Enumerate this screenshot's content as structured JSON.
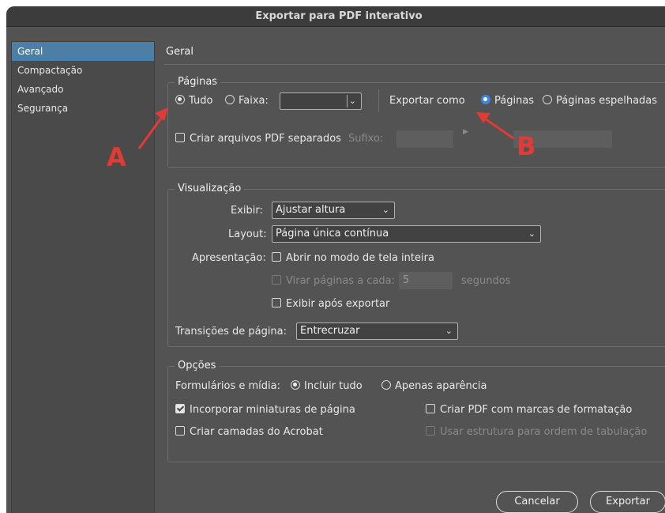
{
  "window": {
    "title": "Exportar para PDF interativo"
  },
  "sidebar": {
    "items": [
      {
        "label": "Geral"
      },
      {
        "label": "Compactação"
      },
      {
        "label": "Avançado"
      },
      {
        "label": "Segurança"
      }
    ]
  },
  "main": {
    "title": "Geral"
  },
  "pages": {
    "title": "Páginas",
    "all_label": "Tudo",
    "range_label": "Faixa:",
    "range_value": "",
    "export_as_label": "Exportar como",
    "pages_option": "Páginas",
    "spreads_option": "Páginas espelhadas",
    "separate_pdf_label": "Criar arquivos PDF separados",
    "suffix_label": "Sufixo:"
  },
  "view": {
    "title": "Visualização",
    "display_label": "Exibir:",
    "display_value": "Ajustar altura",
    "layout_label": "Layout:",
    "layout_value": "Página única contínua",
    "presentation_label": "Apresentação:",
    "fullscreen_label": "Abrir no modo de tela inteira",
    "flip_label": "Virar páginas a cada:",
    "flip_value": "5",
    "seconds_label": "segundos",
    "view_after_label": "Exibir após exportar",
    "transitions_label": "Transições de página:",
    "transitions_value": "Entrecruzar"
  },
  "options": {
    "title": "Opções",
    "forms_label": "Formulários e mídia:",
    "include_all": "Incluir tudo",
    "appearance_only": "Apenas aparência",
    "thumbnails_label": "Incorporar miniaturas de página",
    "tagged_pdf_label": "Criar PDF com marcas de formatação",
    "acrobat_layers_label": "Criar camadas do Acrobat",
    "tab_order_label": "Usar estrutura para ordem de tabulação"
  },
  "buttons": {
    "cancel": "Cancelar",
    "export": "Exportar"
  },
  "annotations": {
    "a": "A",
    "b": "B"
  },
  "colors": {
    "accent": "#3d86e0",
    "selection": "#4d7fa6",
    "annotation": "#e23a35",
    "panel": "#535353"
  }
}
